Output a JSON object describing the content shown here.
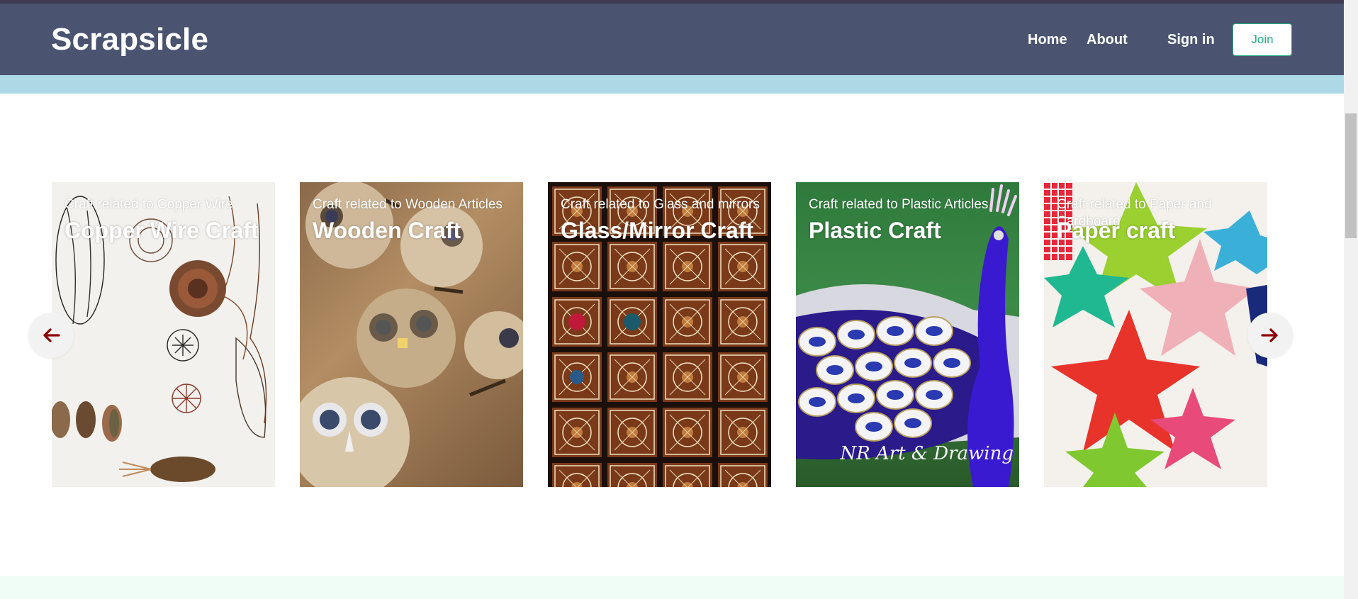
{
  "navbar": {
    "brand": "Scrapsicle",
    "links": [
      "Home",
      "About",
      "Sign in"
    ],
    "join_label": "Join"
  },
  "carousel": {
    "cards": [
      {
        "subtitle": "Craft related to Copper Wire",
        "title": "Copper Wire Craft"
      },
      {
        "subtitle": "Craft related to Wooden Articles",
        "title": "Wooden Craft"
      },
      {
        "subtitle": "Craft related to Glass and mirrors",
        "title": "Glass/Mirror Craft"
      },
      {
        "subtitle": "Craft related to Plastic Articles",
        "title": "Plastic Craft",
        "watermark": "NR Art & Drawing"
      },
      {
        "subtitle": "Craft related to Paper and Cardboard",
        "title": "Paper craft"
      }
    ],
    "prev_icon": "arrow-left-icon",
    "next_icon": "arrow-right-icon"
  },
  "colors": {
    "navbar": "#4a5470",
    "accent": "#22b27f",
    "banner": "#add8e6",
    "arrow": "#8b0000"
  }
}
